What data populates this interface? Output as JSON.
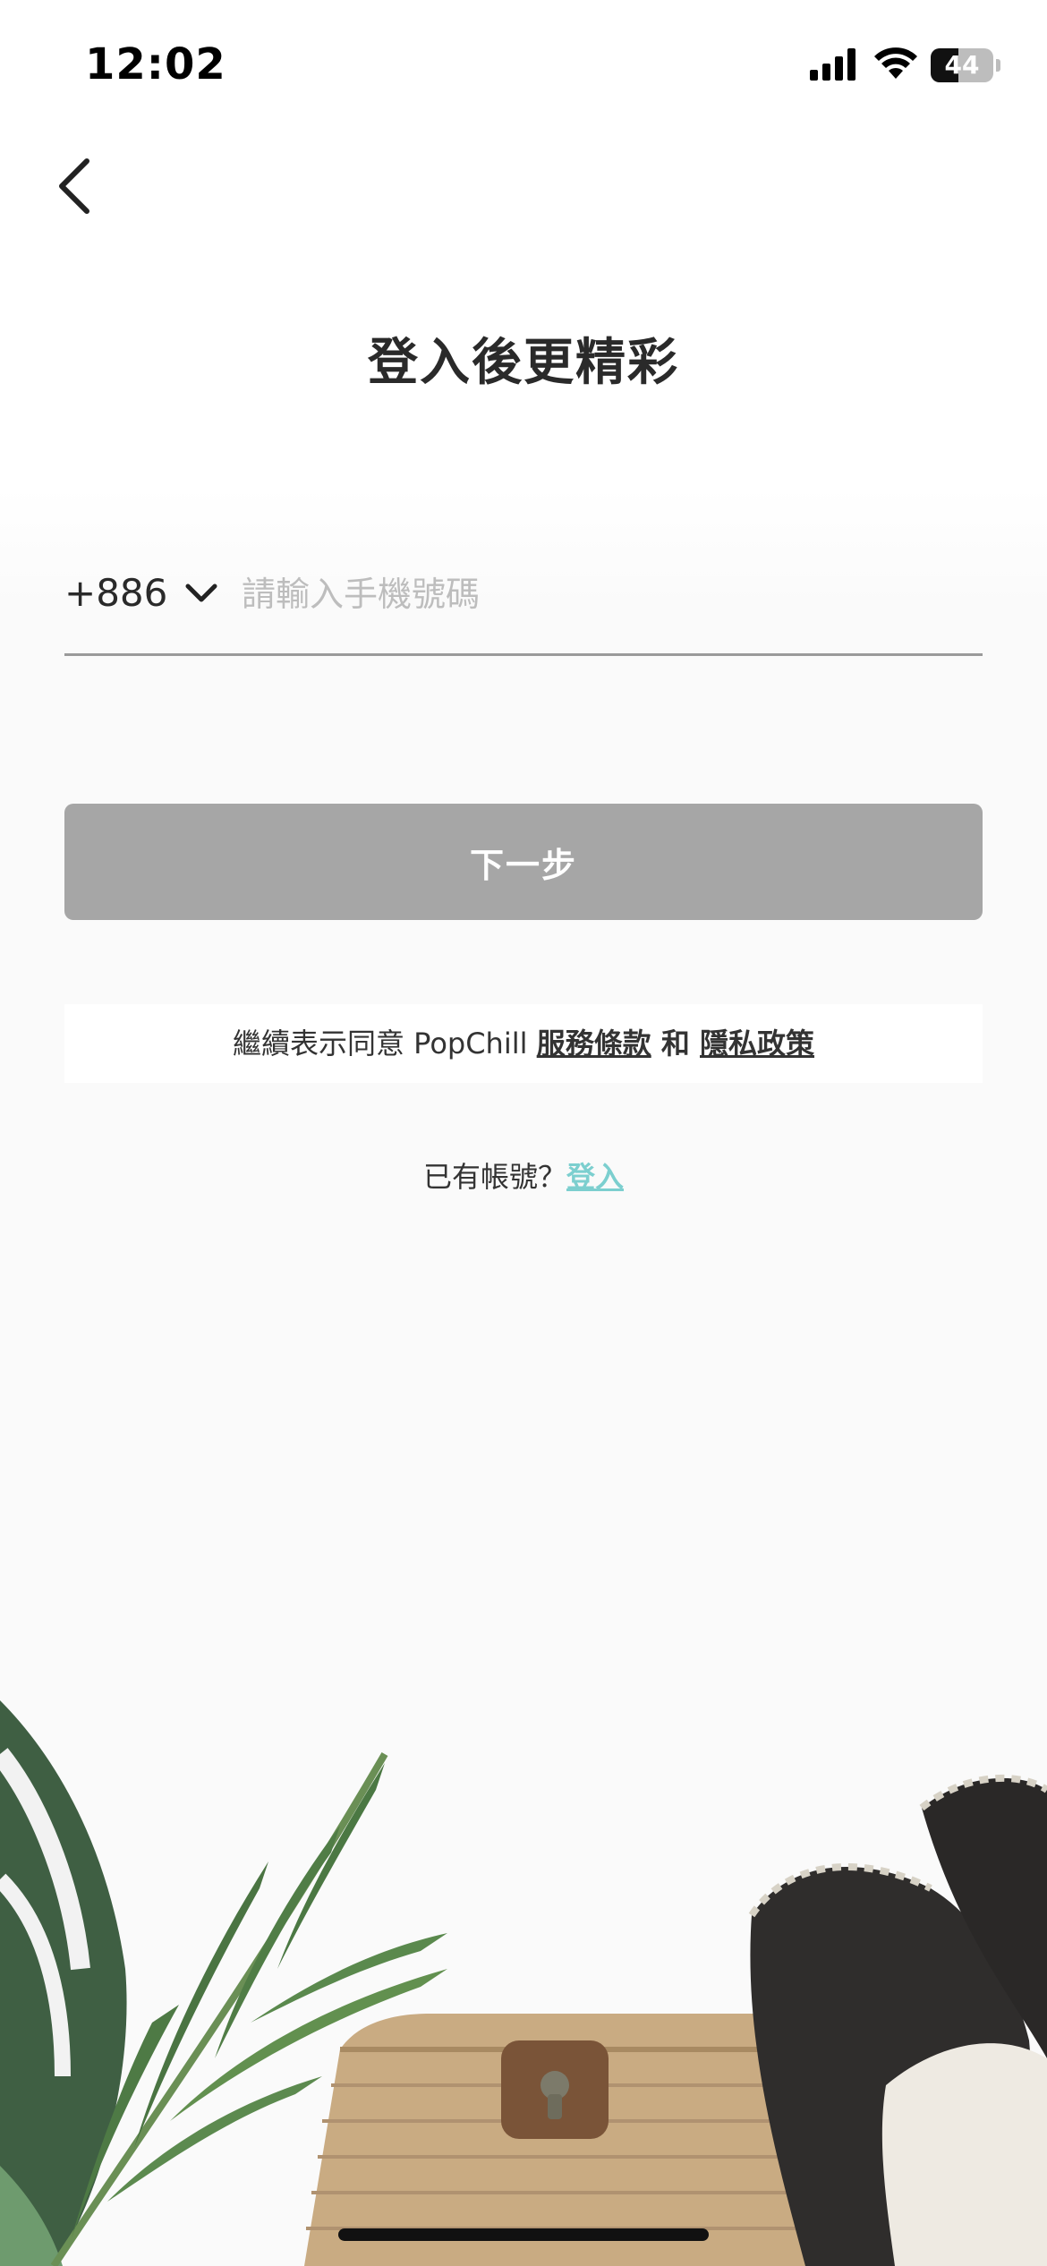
{
  "status_bar": {
    "time": "12:02",
    "battery": "44",
    "battery_level": 0.44,
    "icons": [
      "signal-icon",
      "wifi-icon",
      "battery-icon"
    ]
  },
  "nav": {
    "back_icon": "chevron-left-icon"
  },
  "title": "登入後更精彩",
  "phone": {
    "country_code": "+886",
    "placeholder": "請輸入手機號碼",
    "value": ""
  },
  "next_button": {
    "label": "下一步"
  },
  "terms": {
    "prefix": "繼續表示同意 PopChill ",
    "terms_link": "服務條款",
    "conjunction": " 和 ",
    "privacy_link": "隱私政策"
  },
  "login_prompt": {
    "text": "已有帳號？",
    "link": "登入"
  },
  "colors": {
    "accent": "#7ccfcf",
    "button_disabled": "#a6a6a6",
    "background": "#fafafa"
  }
}
